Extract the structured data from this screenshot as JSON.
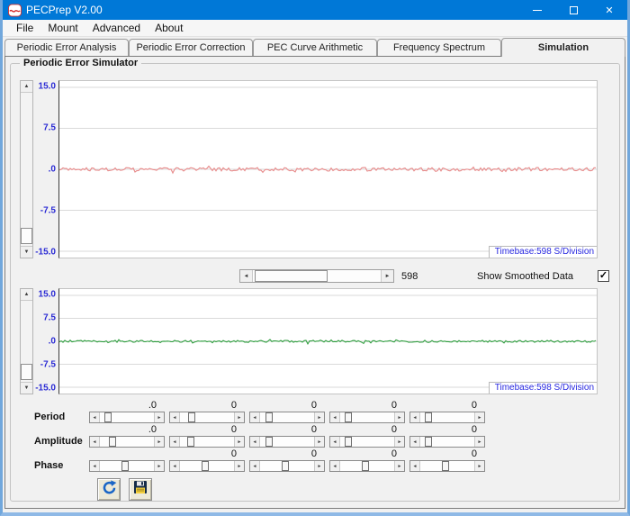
{
  "window": {
    "title": "PECPrep V2.00"
  },
  "icons": {
    "close": "✕",
    "scroll_up": "▲",
    "scroll_down": "▼",
    "scroll_left": "◄",
    "scroll_right": "►",
    "check": "✓"
  },
  "menu": {
    "items": [
      "File",
      "Mount",
      "Advanced",
      "About"
    ]
  },
  "tabs": [
    {
      "label": "Periodic Error Analysis",
      "active": false
    },
    {
      "label": "Periodic Error Correction",
      "active": false
    },
    {
      "label": "PEC Curve Arithmetic",
      "active": false
    },
    {
      "label": "Frequency Spectrum",
      "active": false
    },
    {
      "label": "Simulation",
      "active": true
    }
  ],
  "simulator": {
    "group_title": "Periodic Error Simulator",
    "charts": [
      {
        "y_ticks": [
          "15.0",
          "7.5",
          ".0",
          "-7.5",
          "-15.0"
        ],
        "timebase": "Timebase:598 S/Division",
        "line_color": "#e88a8a"
      },
      {
        "y_ticks": [
          "15.0",
          "7.5",
          ".0",
          "-7.5",
          "-15.0"
        ],
        "timebase": "Timebase:598 S/Division",
        "line_color": "#2f9e3f"
      }
    ],
    "scroll_value": "598",
    "smoothed": {
      "label": "Show Smoothed Data",
      "checked": true
    },
    "slider_rows": [
      {
        "label": "Period",
        "values": [
          ".0",
          "0",
          "0",
          "0",
          "0"
        ],
        "thumbs": [
          8,
          16,
          9,
          8,
          8
        ]
      },
      {
        "label": "Amplitude",
        "values": [
          ".0",
          "0",
          "0",
          "0",
          "0"
        ],
        "thumbs": [
          18,
          14,
          9,
          8,
          8
        ]
      },
      {
        "label": "Phase",
        "values": [
          "",
          "0",
          "0",
          "0",
          "0"
        ],
        "thumbs": [
          44,
          44,
          44,
          44,
          44
        ]
      }
    ]
  }
}
